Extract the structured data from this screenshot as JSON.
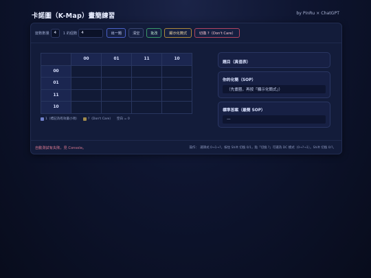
{
  "header": {
    "title": "卡諾圖（K-Map）畫簡練習",
    "byline": "by PinRu × ChatGPT"
  },
  "toolbar": {
    "var_count_label": "變數數量",
    "var_count_value": "4",
    "ones_count_label": "1 的個數",
    "ones_count_value": "4",
    "btn_new": "出一題",
    "btn_clear": "清空",
    "btn_check": "批改",
    "btn_show": "顯示化簡式",
    "btn_dc": "切換 ?（Don't Care）"
  },
  "kmap": {
    "col_headers": [
      "00",
      "01",
      "11",
      "10"
    ],
    "row_headers": [
      "00",
      "01",
      "11",
      "10"
    ],
    "cells": [
      [
        "",
        "",
        "",
        ""
      ],
      [
        "",
        "",
        "",
        ""
      ],
      [
        "",
        "",
        "",
        ""
      ],
      [
        "",
        "",
        "",
        ""
      ]
    ]
  },
  "legend": {
    "one_label": "1（標記為有效最小項）",
    "dc_label": "?（Don't Care）",
    "empty_label": "空白 = 0"
  },
  "cards": {
    "question_title": "題目（真值表）",
    "your_sop_title": "你的化簡（SOP）",
    "your_sop_value": "（先畫圈，再按「顯示化簡式」）",
    "answer_title": "標準答案（最簡 SOP）",
    "answer_value": "—"
  },
  "footer": {
    "left_text": "自動測試有失敗，見 Console。",
    "right_text": "操作：　選擇式 0→1→?，按住 Shift 切換 0/1，點「切換 ?」可選為 DC 模式（0→?→1）。Shift 切換 0/?。"
  },
  "colors": {
    "accent_blue": "#4b61c9",
    "accent_green": "#3a9a69",
    "accent_gold": "#b08a3a",
    "accent_red": "#b24560",
    "error_text": "#d77890"
  }
}
